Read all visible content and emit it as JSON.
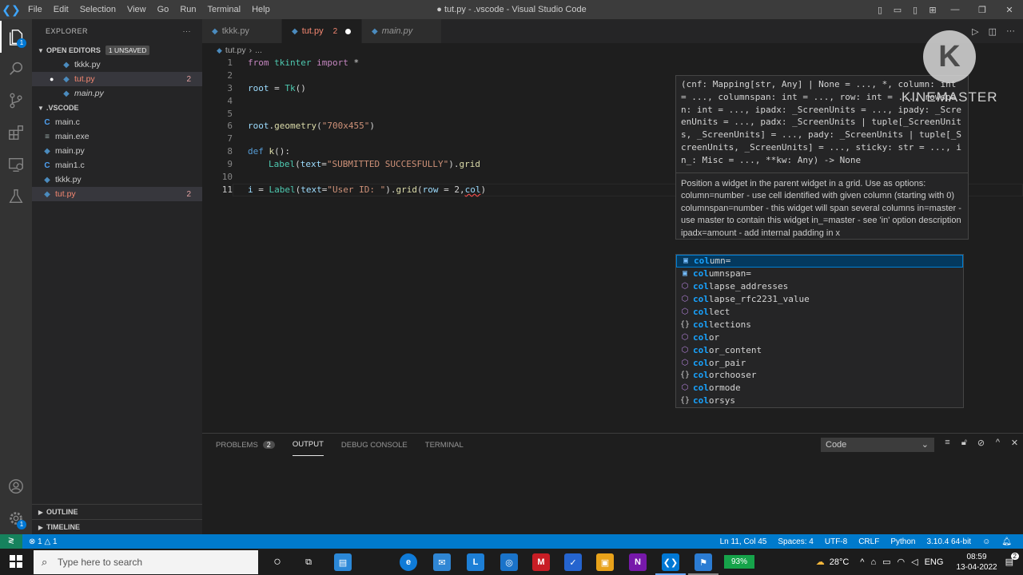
{
  "titlebar": {
    "menu": [
      "File",
      "Edit",
      "Selection",
      "View",
      "Go",
      "Run",
      "Terminal",
      "Help"
    ],
    "title": "● tut.py - .vscode - Visual Studio Code"
  },
  "sidebar": {
    "header": "EXPLORER",
    "open_editors_label": "OPEN EDITORS",
    "unsaved_badge": "1 UNSAVED",
    "open_editors": [
      {
        "name": "tkkk.py",
        "status": ""
      },
      {
        "name": "tut.py",
        "status": "2"
      },
      {
        "name": "main.py",
        "status": ""
      }
    ],
    "folder_label": ".VSCODE",
    "files": [
      {
        "icon": "C",
        "name": "main.c",
        "status": ""
      },
      {
        "icon": "≡",
        "name": "main.exe",
        "status": ""
      },
      {
        "icon": "py",
        "name": "main.py",
        "status": ""
      },
      {
        "icon": "C",
        "name": "main1.c",
        "status": ""
      },
      {
        "icon": "py",
        "name": "tkkk.py",
        "status": ""
      },
      {
        "icon": "py",
        "name": "tut.py",
        "status": "2"
      }
    ],
    "outline_label": "OUTLINE",
    "timeline_label": "TIMELINE"
  },
  "tabs": [
    {
      "name": "tkkk.py",
      "extra": ""
    },
    {
      "name": "tut.py",
      "extra": "2"
    },
    {
      "name": "main.py",
      "extra": ""
    }
  ],
  "breadcrumb": {
    "file": "tut.py",
    "rest": "..."
  },
  "editor": {
    "line_numbers": [
      "1",
      "2",
      "3",
      "4",
      "5",
      "6",
      "7",
      "8",
      "9",
      "10",
      "11"
    ]
  },
  "hover": {
    "signature": "(cnf: Mapping[str, Any] | None = ..., *, column: int = ..., columnspan: int = ..., row: int = ..., rowspan: int = ..., ipadx: _ScreenUnits = ..., ipady: _ScreenUnits = ..., padx: _ScreenUnits | tuple[_ScreenUnits, _ScreenUnits] = ..., pady: _ScreenUnits | tuple[_ScreenUnits, _ScreenUnits] = ..., sticky: str = ..., in_: Misc = ..., **kw: Any) -> None",
    "doc": "Position a widget in the parent widget in a grid. Use as options: column=number - use cell identified with given column (starting with 0) columnspan=number - this widget will span several columns in=master - use master to contain this widget in_=master - see 'in' option description ipadx=amount - add internal padding in x"
  },
  "suggestions": [
    {
      "kind": "field",
      "match": "col",
      "rest": "umn="
    },
    {
      "kind": "field",
      "match": "col",
      "rest": "umnspan="
    },
    {
      "kind": "module",
      "match": "col",
      "rest": "lapse_addresses"
    },
    {
      "kind": "module",
      "match": "col",
      "rest": "lapse_rfc2231_value"
    },
    {
      "kind": "module",
      "match": "col",
      "rest": "lect"
    },
    {
      "kind": "braces",
      "match": "col",
      "rest": "lections"
    },
    {
      "kind": "module",
      "match": "col",
      "rest": "or"
    },
    {
      "kind": "module",
      "match": "col",
      "rest": "or_content"
    },
    {
      "kind": "module",
      "match": "col",
      "rest": "or_pair"
    },
    {
      "kind": "braces",
      "match": "col",
      "rest": "orchooser"
    },
    {
      "kind": "module",
      "match": "col",
      "rest": "ormode"
    },
    {
      "kind": "braces",
      "match": "col",
      "rest": "orsys"
    }
  ],
  "watermark": {
    "letter": "K",
    "text": "KINEMASTER"
  },
  "panel": {
    "tabs": [
      "PROBLEMS",
      "OUTPUT",
      "DEBUG CONSOLE",
      "TERMINAL"
    ],
    "problems_count": "2",
    "output_channel": "Code"
  },
  "status": {
    "problems": "⊗ 1 △ 1",
    "position": "Ln 11, Col 45",
    "spaces": "Spaces: 4",
    "encoding": "UTF-8",
    "eol": "CRLF",
    "language": "Python",
    "interpreter": "3.10.4 64-bit"
  },
  "taskbar": {
    "search_placeholder": "Type here to search",
    "battery": "93%",
    "weather": "28°C",
    "lang": "ENG",
    "time": "08:59",
    "date": "13-04-2022",
    "notif_count": "2"
  }
}
